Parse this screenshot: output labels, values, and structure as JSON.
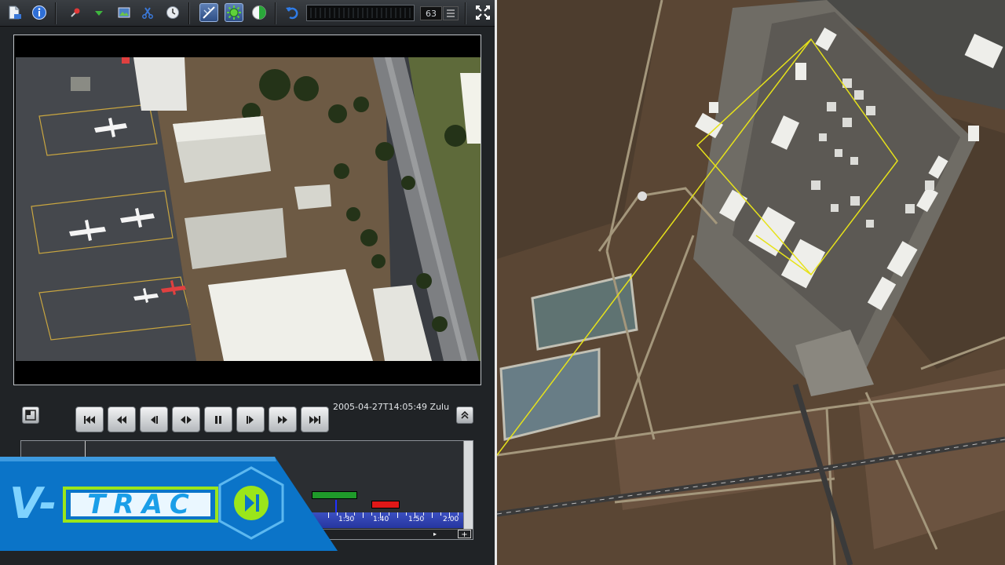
{
  "toolbar": {
    "buttons": [
      {
        "name": "new-document-icon"
      },
      {
        "name": "info-icon"
      },
      {
        "name": "pin-icon"
      },
      {
        "name": "marker-icon"
      },
      {
        "name": "image-map-icon"
      },
      {
        "name": "scissors-icon"
      },
      {
        "name": "clock-icon"
      },
      {
        "name": "measure-icon",
        "active": true
      },
      {
        "name": "sun-icon",
        "active": true
      },
      {
        "name": "globe-icon"
      },
      {
        "name": "undo-icon"
      },
      {
        "name": "fullscreen-icon"
      }
    ],
    "zoom_value": "63"
  },
  "player": {
    "timestamp": "2005-04-27T14:05:49 Zulu",
    "controls": [
      "skip-to-start",
      "rewind",
      "step-back",
      "play-reverse",
      "pause",
      "step-forward",
      "fast-forward",
      "skip-to-end"
    ]
  },
  "timeline": {
    "tick_labels": [
      "1:30",
      "1:40",
      "1:50",
      "2:00"
    ]
  },
  "logo": {
    "prefix": "V-",
    "text": "TRAC"
  },
  "colors": {
    "ui_bg": "#202326",
    "timeline_ruler": "#2636a0",
    "track_green": "#1f9a2a",
    "track_red": "#e01818",
    "logo_blue": "#0b74c8",
    "logo_green": "#9be61a",
    "footprint_line": "#e6e21a"
  }
}
